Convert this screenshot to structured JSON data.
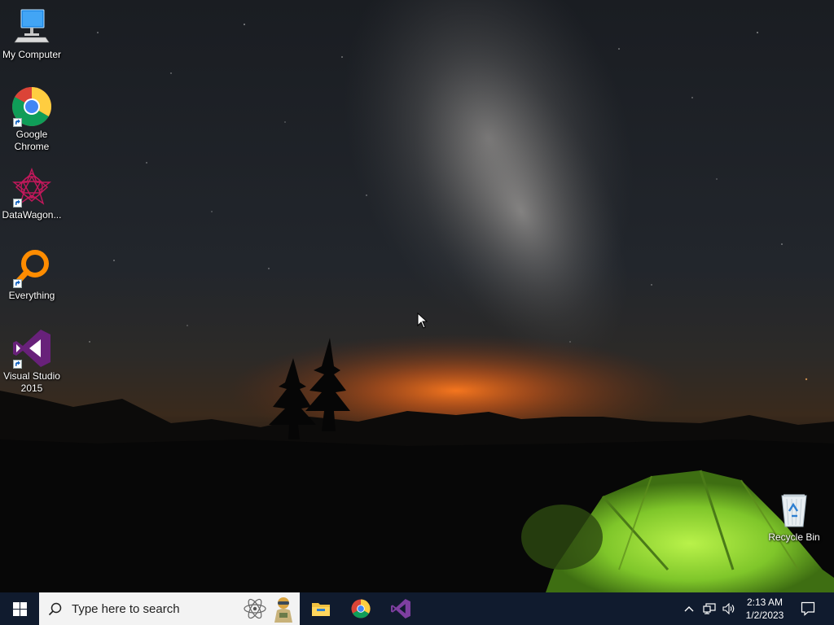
{
  "desktop": {
    "icons": [
      {
        "label": "My Computer",
        "icon": "computer-icon"
      },
      {
        "label": "Google Chrome",
        "icon": "chrome-icon"
      },
      {
        "label": "DataWagon...",
        "icon": "datawagon-icon"
      },
      {
        "label": "Everything",
        "icon": "everything-search-icon"
      },
      {
        "label": "Visual Studio 2015",
        "icon": "visual-studio-icon"
      },
      {
        "label": "Recycle Bin",
        "icon": "recycle-bin-icon"
      }
    ]
  },
  "taskbar": {
    "start_icon": "windows-logo-icon",
    "search": {
      "placeholder": "Type here to search",
      "icon": "search-icon"
    },
    "pinned_apps": [
      {
        "name": "File Explorer",
        "icon": "file-explorer-icon"
      },
      {
        "name": "Google Chrome",
        "icon": "chrome-icon"
      },
      {
        "name": "Visual Studio",
        "icon": "visual-studio-icon"
      }
    ],
    "tray": {
      "chevron_icon": "chevron-up-icon",
      "network_icon": "network-icon",
      "volume_icon": "volume-icon",
      "time": "2:13 AM",
      "date": "1/2/2023",
      "notification_icon": "notification-icon"
    }
  },
  "colors": {
    "taskbar_bg": "#101b2e",
    "search_bg": "#f3f3f3",
    "sky_top": "#14171c",
    "horizon_glow": "#e8641a",
    "tent_green": "#8ad12b",
    "desktop_text": "#ffffff"
  }
}
